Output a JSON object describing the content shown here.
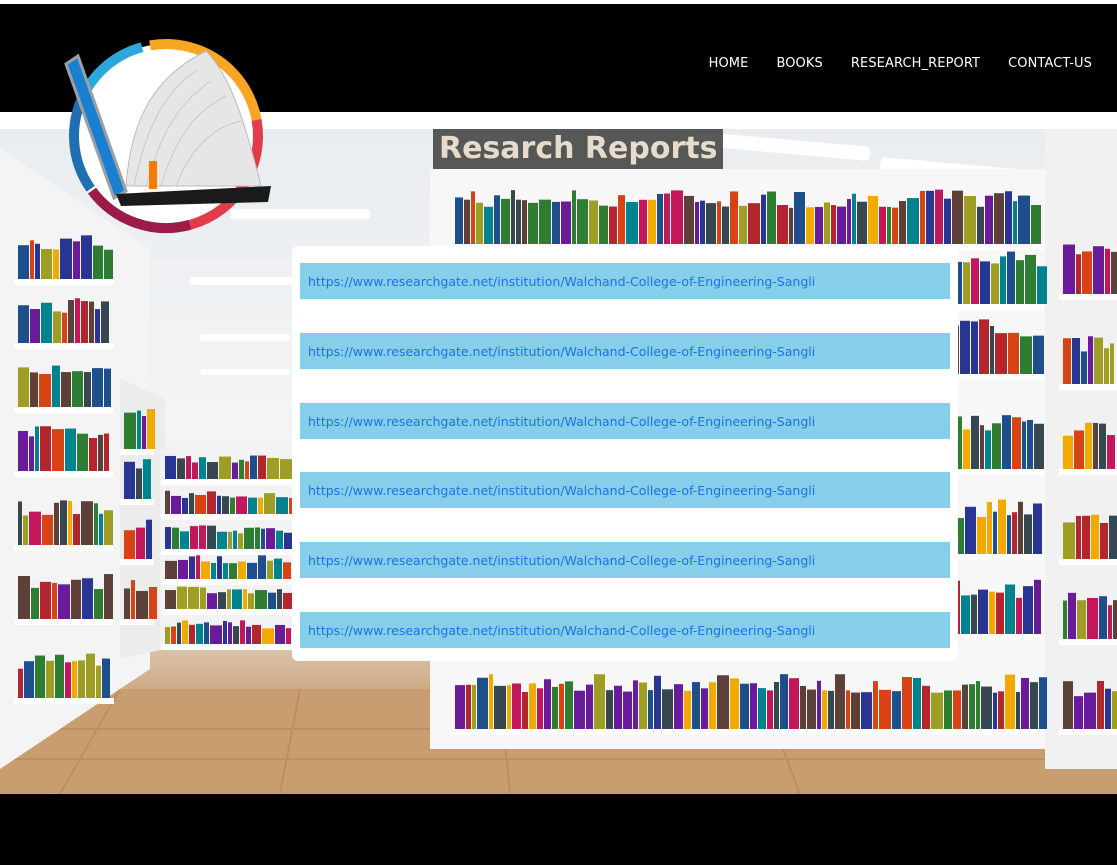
{
  "navbar": {
    "links": [
      {
        "label": "HOME"
      },
      {
        "label": "BOOKS"
      },
      {
        "label": "RESEARCH_REPORT"
      },
      {
        "label": "CONTACT-US"
      }
    ]
  },
  "logo": {
    "icon": "book-laptop-logo-icon"
  },
  "main": {
    "heading": "Resarch Reports",
    "reports": [
      {
        "url": "https://www.researchgate.net/institution/Walchand-College-of-Engineering-Sangli"
      },
      {
        "url": "https://www.researchgate.net/institution/Walchand-College-of-Engineering-Sangli"
      },
      {
        "url": "https://www.researchgate.net/institution/Walchand-College-of-Engineering-Sangli"
      },
      {
        "url": "https://www.researchgate.net/institution/Walchand-College-of-Engineering-Sangli"
      },
      {
        "url": "https://www.researchgate.net/institution/Walchand-College-of-Engineering-Sangli"
      },
      {
        "url": "https://www.researchgate.net/institution/Walchand-College-of-Engineering-Sangli"
      }
    ]
  },
  "colors": {
    "navbar_bg": "#000000",
    "report_item_bg": "#87ceeb",
    "link_color": "#1a73e8",
    "heading_text": "#e7dccb"
  }
}
